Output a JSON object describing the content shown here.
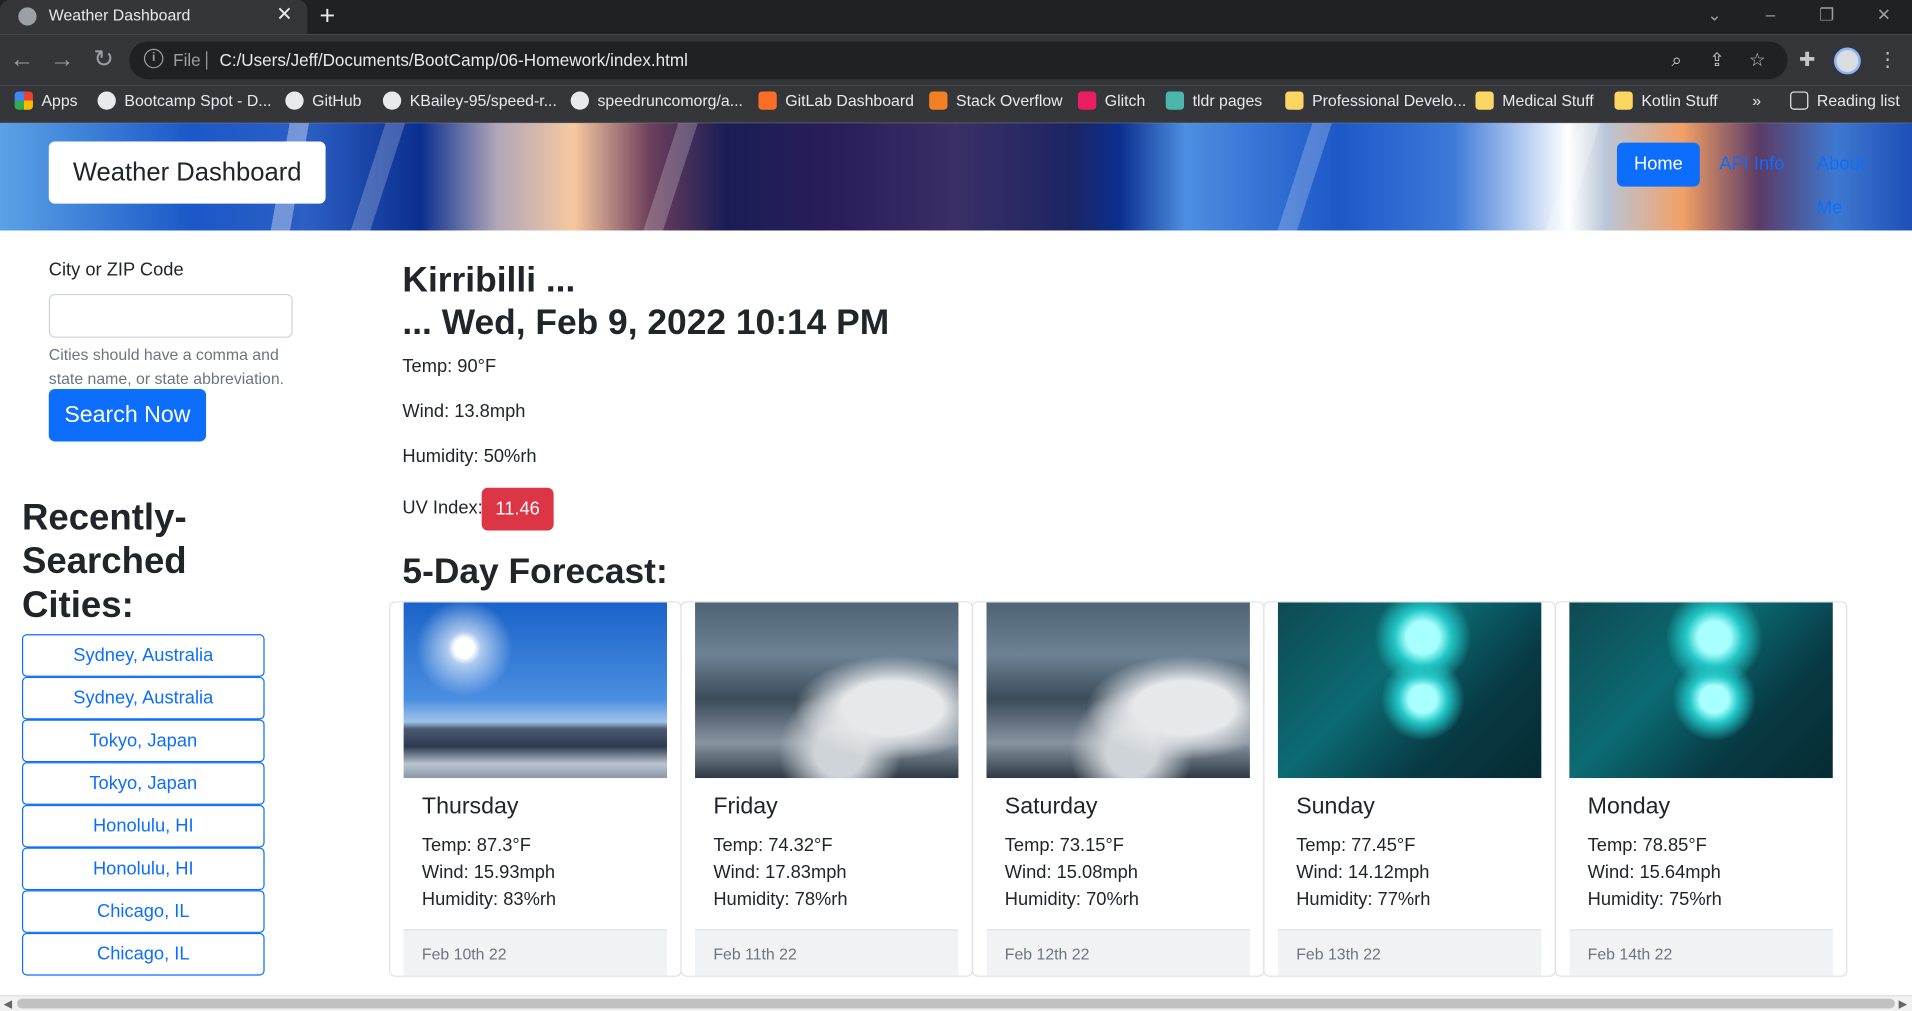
{
  "browser": {
    "tab_title": "Weather Dashboard",
    "tab_close": "✕",
    "new_tab": "+",
    "url_scheme": "File",
    "url": "C:/Users/Jeff/Documents/BootCamp/06-Homework/index.html",
    "bookmarks": [
      "Apps",
      "Bootcamp Spot - D...",
      "GitHub",
      "KBailey-95/speed-r...",
      "speedruncomorg/a...",
      "GitLab Dashboard",
      "Stack Overflow",
      "Glitch",
      "tldr pages",
      "Professional Develo...",
      "Medical Stuff",
      "Kotlin Stuff"
    ],
    "more_bookmarks": "»",
    "reading_list": "Reading list"
  },
  "header": {
    "brand": "Weather Dashboard",
    "nav": [
      "Home",
      "API Info",
      "About Me"
    ]
  },
  "search": {
    "label": "City or ZIP Code",
    "input_value": "",
    "help": "Cities should have a comma and state name, or state abbreviation.",
    "button": "Search Now"
  },
  "recent": {
    "heading": "Recently-Searched Cities:",
    "cities": [
      "Sydney, Australia",
      "Sydney, Australia",
      "Tokyo, Japan",
      "Tokyo, Japan",
      "Honolulu, HI",
      "Honolulu, HI",
      "Chicago, IL",
      "Chicago, IL"
    ]
  },
  "current": {
    "city": "Kirribilli ...",
    "datetime": "... Wed, Feb 9, 2022 10:14 PM",
    "temp": "Temp: 90°F",
    "wind": "Wind: 13.8mph",
    "humidity": "Humidity: 50%rh",
    "uv_label": "UV Index:",
    "uv_value": "11.46",
    "uv_color": "#dc3545"
  },
  "forecast": {
    "title": "5-Day Forecast:",
    "days": [
      {
        "day": "Thursday",
        "temp": "Temp: 87.3°F",
        "wind": "Wind: 15.93mph",
        "humidity": "Humidity: 83%rh",
        "date": "Feb 10th 22",
        "image": "sunny"
      },
      {
        "day": "Friday",
        "temp": "Temp: 74.32°F",
        "wind": "Wind: 17.83mph",
        "humidity": "Humidity: 78%rh",
        "date": "Feb 11th 22",
        "image": "cloudy"
      },
      {
        "day": "Saturday",
        "temp": "Temp: 73.15°F",
        "wind": "Wind: 15.08mph",
        "humidity": "Humidity: 70%rh",
        "date": "Feb 12th 22",
        "image": "cloudy"
      },
      {
        "day": "Sunday",
        "temp": "Temp: 77.45°F",
        "wind": "Wind: 14.12mph",
        "humidity": "Humidity: 77%rh",
        "date": "Feb 13th 22",
        "image": "rain"
      },
      {
        "day": "Monday",
        "temp": "Temp: 78.85°F",
        "wind": "Wind: 15.64mph",
        "humidity": "Humidity: 75%rh",
        "date": "Feb 14th 22",
        "image": "rain"
      }
    ]
  },
  "colors": {
    "primary": "#0d6efd",
    "danger": "#dc3545"
  }
}
